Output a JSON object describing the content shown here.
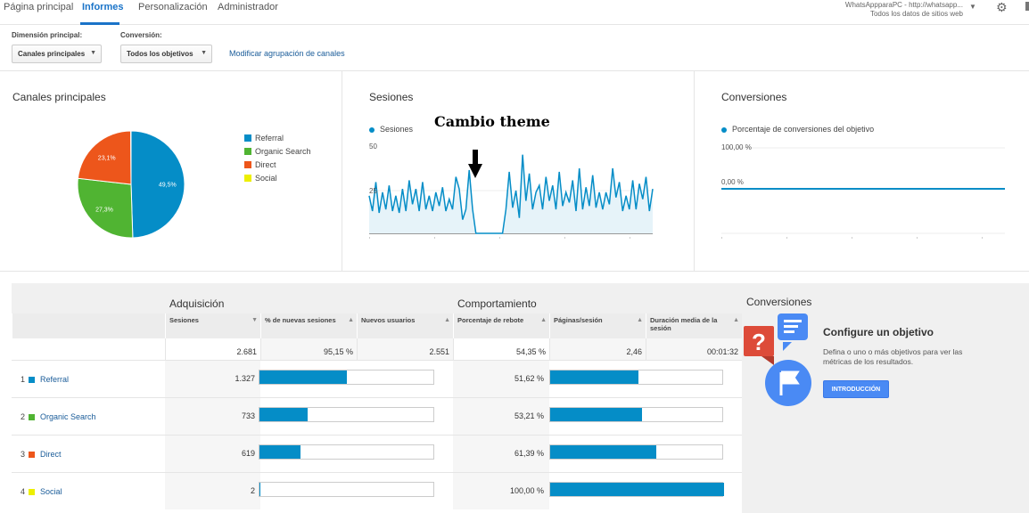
{
  "nav": {
    "tabs": [
      "Página principal",
      "Informes",
      "Personalización",
      "Administrador"
    ],
    "active": "Informes",
    "account_line1": "WhatsAppparaPC - http://whatsapp...",
    "account_line2": "Todos los datos de sitios web"
  },
  "filters": {
    "dimension_label": "Dimensión principal:",
    "dimension_value": "Canales principales",
    "conversion_label": "Conversión:",
    "conversion_value": "Todos los objetivos",
    "modify_link": "Modificar agrupación de canales"
  },
  "panels": {
    "channels_title": "Canales principales",
    "sessions_title": "Sesiones",
    "conversions_title": "Conversiones",
    "sessions_legend": "Sesiones",
    "conversions_legend": "Porcentaje de conversiones del objetivo"
  },
  "annotation": "Cambio theme",
  "colors": {
    "referral": "#058dc7",
    "organic": "#50b432",
    "direct": "#ed561b",
    "social": "#edef00",
    "accent": "#1a73c8"
  },
  "chart_data": [
    {
      "type": "pie",
      "title": "Canales principales",
      "labels": [
        "Referral",
        "Organic Search",
        "Direct",
        "Social"
      ],
      "values": [
        49.5,
        27.3,
        23.1,
        0.1
      ],
      "data_labels": [
        "49,5%",
        "27,3%",
        "23,1%",
        ""
      ]
    },
    {
      "type": "area",
      "title": "Sesiones",
      "series": [
        {
          "name": "Sesiones",
          "values": [
            22,
            13,
            30,
            12,
            24,
            14,
            28,
            13,
            22,
            12,
            26,
            13,
            31,
            17,
            26,
            13,
            30,
            14,
            22,
            13,
            24,
            16,
            27,
            13,
            20,
            14,
            33,
            26,
            8,
            14,
            37,
            14,
            0,
            0,
            0,
            0,
            0,
            0,
            0,
            0,
            0,
            14,
            36,
            15,
            25,
            9,
            46,
            19,
            35,
            14,
            24,
            28,
            14,
            33,
            19,
            28,
            14,
            36,
            16,
            24,
            18,
            31,
            13,
            38,
            14,
            27,
            16,
            34,
            15,
            24,
            14,
            24,
            17,
            38,
            21,
            30,
            13,
            22,
            14,
            31,
            14,
            29,
            20,
            33,
            13,
            26
          ]
        }
      ],
      "y_ticks": [
        "50",
        "25"
      ],
      "ylim": [
        0,
        50
      ]
    },
    {
      "type": "line",
      "title": "Conversiones",
      "series": [
        {
          "name": "Porcentaje de conversiones del objetivo",
          "values": [
            0,
            0,
            0,
            0,
            0,
            0,
            0,
            0,
            0,
            0
          ]
        }
      ],
      "y_ticks": [
        "100,00 %",
        "0,00 %"
      ],
      "ylim": [
        0,
        100
      ]
    }
  ],
  "table": {
    "group_headers": [
      "Adquisición",
      "Comportamiento"
    ],
    "columns": [
      "Sesiones",
      "% de nuevas sesiones",
      "Nuevos usuarios",
      "Porcentaje de rebote",
      "Páginas/sesión",
      "Duración media de la sesión"
    ],
    "totals": [
      "2.681",
      "95,15 %",
      "2.551",
      "54,35 %",
      "2,46",
      "00:01:32"
    ],
    "rows": [
      {
        "rank": "1",
        "name": "Referral",
        "sessions": "1.327",
        "new_pct": 49.5,
        "bounce": "51,62 %",
        "pages": 51
      },
      {
        "rank": "2",
        "name": "Organic Search",
        "sessions": "733",
        "new_pct": 27.3,
        "bounce": "53,21 %",
        "pages": 53
      },
      {
        "rank": "3",
        "name": "Direct",
        "sessions": "619",
        "new_pct": 23.1,
        "bounce": "61,39 %",
        "pages": 61
      },
      {
        "rank": "4",
        "name": "Social",
        "sessions": "2",
        "new_pct": 0.5,
        "bounce": "100,00 %",
        "pages": 100
      }
    ]
  },
  "conversions_box": {
    "title": "Conversiones",
    "heading": "Configure un objetivo",
    "description": "Defina o uno o más objetivos para ver las métricas de los resultados.",
    "button": "INTRODUCCIÓN"
  }
}
